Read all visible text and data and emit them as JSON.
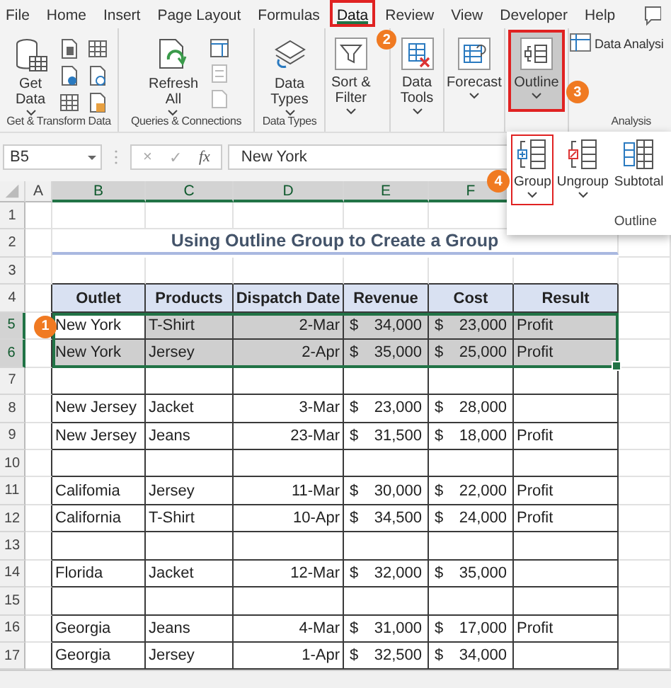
{
  "tabs": [
    {
      "label": "File",
      "selected": false,
      "highlighted": false
    },
    {
      "label": "Home",
      "selected": false,
      "highlighted": false
    },
    {
      "label": "Insert",
      "selected": false,
      "highlighted": false
    },
    {
      "label": "Page Layout",
      "selected": false,
      "highlighted": false
    },
    {
      "label": "Formulas",
      "selected": false,
      "highlighted": false
    },
    {
      "label": "Data",
      "selected": true,
      "highlighted": true,
      "callout": "2"
    },
    {
      "label": "Review",
      "selected": false,
      "highlighted": false
    },
    {
      "label": "View",
      "selected": false,
      "highlighted": false
    },
    {
      "label": "Developer",
      "selected": false,
      "highlighted": false
    },
    {
      "label": "Help",
      "selected": false,
      "highlighted": false
    }
  ],
  "ribbon": {
    "groups": [
      {
        "label": "Get & Transform Data",
        "kind": "transform",
        "buttons": [
          {
            "kind": "database",
            "lines": [
              "Get",
              "Data"
            ],
            "dropdown": true,
            "highlighted": false
          }
        ]
      },
      {
        "label": "Queries & Connections",
        "kind": "queries",
        "buttons": [
          {
            "kind": "refresh",
            "lines": [
              "Refresh",
              "All"
            ],
            "dropdown": true,
            "highlighted": false
          }
        ]
      },
      {
        "label": "Data Types",
        "kind": "plain",
        "buttons": [
          {
            "kind": "layers",
            "lines": [
              "Data",
              "Types"
            ],
            "dropdown": true,
            "highlighted": false
          }
        ]
      },
      {
        "kind": "plain",
        "buttons": [
          {
            "kind": "filter",
            "lines": [
              "Sort &",
              "Filter"
            ],
            "dropdown": true,
            "highlighted": false
          }
        ]
      },
      {
        "kind": "plain",
        "buttons": [
          {
            "kind": "tools",
            "lines": [
              "Data",
              "Tools"
            ],
            "dropdown": true,
            "highlighted": false
          }
        ]
      },
      {
        "kind": "plain",
        "buttons": [
          {
            "kind": "forecast",
            "lines": [
              "Forecast"
            ],
            "dropdown": true,
            "highlighted": false
          }
        ]
      },
      {
        "kind": "plain",
        "buttons": [
          {
            "kind": "outline",
            "lines": [
              "Outline"
            ],
            "dropdown": true,
            "highlighted": true,
            "callout": "3"
          }
        ]
      },
      {
        "label": "Analysis",
        "kind": "analysis",
        "buttons": [
          {
            "kind": "analysis",
            "lines": [
              "Data Analysi"
            ],
            "dropdown": false,
            "highlighted": false
          }
        ]
      }
    ]
  },
  "formula_bar": {
    "name_box": "B5",
    "cancel": "×",
    "enter": "✓",
    "function": "fx",
    "value": "New York"
  },
  "outline_menu": {
    "label": "Outline",
    "buttons": [
      {
        "kind": "group",
        "label": "Group",
        "dropdown": true,
        "highlighted": true,
        "callout": "4"
      },
      {
        "kind": "ungroup",
        "label": "Ungroup",
        "dropdown": true,
        "highlighted": false
      },
      {
        "kind": "subtotal",
        "label": "Subtotal",
        "dropdown": false,
        "highlighted": false
      }
    ]
  },
  "sheet": {
    "column_headers": [
      {
        "label": "A",
        "selected": false
      },
      {
        "label": "B",
        "selected": true
      },
      {
        "label": "C",
        "selected": true
      },
      {
        "label": "D",
        "selected": true
      },
      {
        "label": "E",
        "selected": true
      },
      {
        "label": "F",
        "selected": true
      }
    ],
    "row_headers": [
      {
        "label": "1",
        "selected": false
      },
      {
        "label": "2",
        "selected": false
      },
      {
        "label": "3",
        "selected": false
      },
      {
        "label": "4",
        "selected": false
      },
      {
        "label": "5",
        "selected": true
      },
      {
        "label": "6",
        "selected": true
      },
      {
        "label": "7",
        "selected": false
      },
      {
        "label": "8",
        "selected": false
      },
      {
        "label": "9",
        "selected": false
      },
      {
        "label": "10",
        "selected": false
      },
      {
        "label": "11",
        "selected": false
      },
      {
        "label": "12",
        "selected": false
      },
      {
        "label": "13",
        "selected": false
      },
      {
        "label": "14",
        "selected": false
      },
      {
        "label": "15",
        "selected": false
      },
      {
        "label": "16",
        "selected": false
      },
      {
        "label": "17",
        "selected": false
      }
    ],
    "title": "Using Outline Group to Create a Group",
    "table": {
      "columns": [
        {
          "label": "Outlet",
          "kind": "text"
        },
        {
          "label": "Products",
          "kind": "text"
        },
        {
          "label": "Dispatch Date",
          "kind": "date"
        },
        {
          "label": "Revenue",
          "kind": "currency"
        },
        {
          "label": "Cost",
          "kind": "currency"
        },
        {
          "label": "Result",
          "kind": "text"
        }
      ],
      "rows": [
        {
          "selected": true,
          "callout": "1",
          "cells": [
            {
              "text": "New York"
            },
            {
              "text": "T-Shirt"
            },
            {
              "text": "2-Mar"
            },
            {
              "symbol": "$",
              "amount": "34,000"
            },
            {
              "symbol": "$",
              "amount": "23,000"
            },
            {
              "text": "Profit"
            }
          ]
        },
        {
          "selected": true,
          "cells": [
            {
              "text": "New York"
            },
            {
              "text": "Jersey"
            },
            {
              "text": "2-Apr"
            },
            {
              "symbol": "$",
              "amount": "35,000"
            },
            {
              "symbol": "$",
              "amount": "25,000"
            },
            {
              "text": "Profit"
            }
          ]
        },
        {
          "selected": false
        },
        {
          "selected": false,
          "cells": [
            {
              "text": "New Jersey"
            },
            {
              "text": "Jacket"
            },
            {
              "text": "3-Mar"
            },
            {
              "symbol": "$",
              "amount": "23,000"
            },
            {
              "symbol": "$",
              "amount": "28,000"
            }
          ]
        },
        {
          "selected": false,
          "cells": [
            {
              "text": "New Jersey"
            },
            {
              "text": "Jeans"
            },
            {
              "text": "23-Mar"
            },
            {
              "symbol": "$",
              "amount": "31,500"
            },
            {
              "symbol": "$",
              "amount": "18,000"
            },
            {
              "text": "Profit"
            }
          ]
        },
        {
          "selected": false
        },
        {
          "selected": false,
          "cells": [
            {
              "text": "Califomia"
            },
            {
              "text": "Jersey"
            },
            {
              "text": "11-Mar"
            },
            {
              "symbol": "$",
              "amount": "30,000"
            },
            {
              "symbol": "$",
              "amount": "22,000"
            },
            {
              "text": "Profit"
            }
          ]
        },
        {
          "selected": false,
          "cells": [
            {
              "text": "California"
            },
            {
              "text": "T-Shirt"
            },
            {
              "text": "10-Apr"
            },
            {
              "symbol": "$",
              "amount": "34,500"
            },
            {
              "symbol": "$",
              "amount": "24,000"
            },
            {
              "text": "Profit"
            }
          ]
        },
        {
          "selected": false
        },
        {
          "selected": false,
          "cells": [
            {
              "text": "Florida"
            },
            {
              "text": "Jacket"
            },
            {
              "text": "12-Mar"
            },
            {
              "symbol": "$",
              "amount": "32,000"
            },
            {
              "symbol": "$",
              "amount": "35,000"
            }
          ]
        },
        {
          "selected": false
        },
        {
          "selected": false,
          "cells": [
            {
              "text": "Georgia"
            },
            {
              "text": "Jeans"
            },
            {
              "text": "4-Mar"
            },
            {
              "symbol": "$",
              "amount": "31,000"
            },
            {
              "symbol": "$",
              "amount": "17,000"
            },
            {
              "text": "Profit"
            }
          ]
        },
        {
          "selected": false,
          "cells": [
            {
              "text": "Georgia"
            },
            {
              "text": "Jersey"
            },
            {
              "text": "1-Apr"
            },
            {
              "symbol": "$",
              "amount": "32,500"
            },
            {
              "symbol": "$",
              "amount": "34,000"
            }
          ]
        }
      ]
    }
  }
}
